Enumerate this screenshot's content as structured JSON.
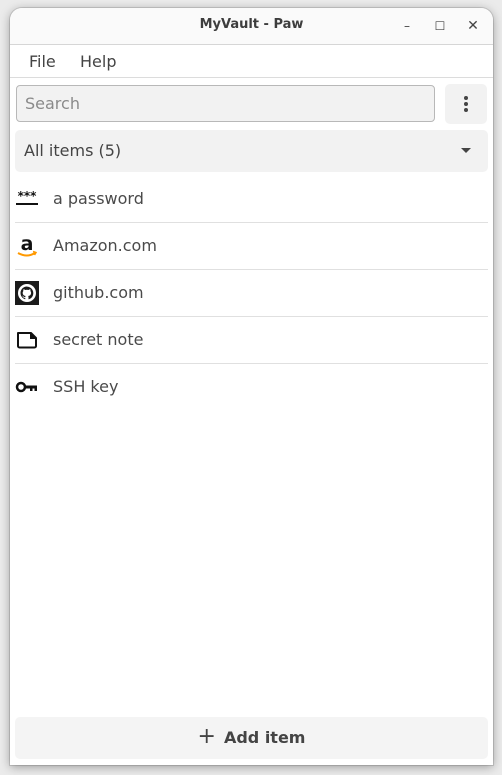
{
  "window": {
    "title": "MyVault - Paw",
    "controls": {
      "minimize": "–",
      "maximize": "☐",
      "close": "✕"
    }
  },
  "menubar": {
    "items": [
      {
        "label": "File"
      },
      {
        "label": "Help"
      }
    ]
  },
  "search": {
    "placeholder": "Search",
    "value": ""
  },
  "more_menu": {
    "icon": "kebab-vertical-icon"
  },
  "filter": {
    "selected": "All items (5)"
  },
  "items": [
    {
      "label": "a password",
      "icon": "password-icon"
    },
    {
      "label": "Amazon.com",
      "icon": "amazon-logo-icon",
      "accent": "#ff9900"
    },
    {
      "label": "github.com",
      "icon": "github-logo-icon"
    },
    {
      "label": "secret note",
      "icon": "note-icon"
    },
    {
      "label": "SSH key",
      "icon": "key-icon"
    }
  ],
  "add_button": {
    "icon": "+",
    "label": "Add item"
  }
}
